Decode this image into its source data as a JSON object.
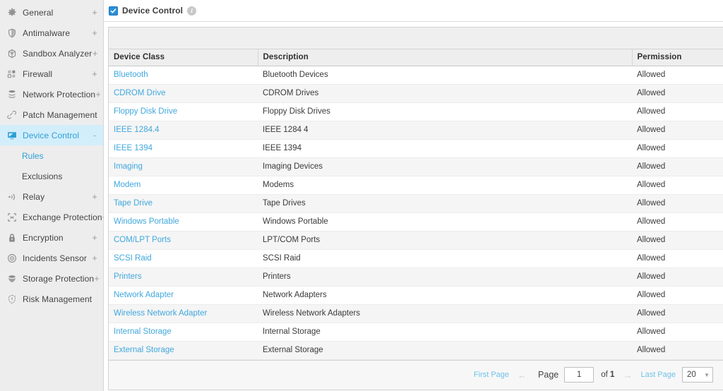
{
  "sidebar": {
    "items": [
      {
        "label": "General",
        "icon": "gear-icon",
        "expander": "+",
        "active": false
      },
      {
        "label": "Antimalware",
        "icon": "shield-half-icon",
        "expander": "+",
        "active": false
      },
      {
        "label": "Sandbox Analyzer",
        "icon": "box-icon",
        "expander": "+",
        "active": false
      },
      {
        "label": "Firewall",
        "icon": "blocks-icon",
        "expander": "+",
        "active": false
      },
      {
        "label": "Network Protection",
        "icon": "stack-icon",
        "expander": "+",
        "active": false
      },
      {
        "label": "Patch Management",
        "icon": "bandage-icon",
        "expander": "",
        "active": false
      },
      {
        "label": "Device Control",
        "icon": "monitor-icon",
        "expander": "-",
        "active": true
      },
      {
        "label": "Relay",
        "icon": "broadcast-icon",
        "expander": "+",
        "active": false
      },
      {
        "label": "Exchange Protection",
        "icon": "exchange-icon",
        "expander": "+",
        "active": false
      },
      {
        "label": "Encryption",
        "icon": "lock-icon",
        "expander": "+",
        "active": false
      },
      {
        "label": "Incidents Sensor",
        "icon": "target-icon",
        "expander": "+",
        "active": false
      },
      {
        "label": "Storage Protection",
        "icon": "storage-icon",
        "expander": "+",
        "active": false
      },
      {
        "label": "Risk Management",
        "icon": "risk-shield-icon",
        "expander": "",
        "active": false
      }
    ],
    "sub_items": [
      {
        "label": "Rules",
        "current": true
      },
      {
        "label": "Exclusions",
        "current": false
      }
    ],
    "sub_after_index": 6
  },
  "header": {
    "title": "Device Control",
    "checkbox_checked": true,
    "info_glyph": "i"
  },
  "table": {
    "columns": [
      "Device Class",
      "Description",
      "Permission"
    ],
    "rows": [
      {
        "device_class": "Bluetooth",
        "description": "Bluetooth Devices",
        "permission": "Allowed"
      },
      {
        "device_class": "CDROM Drive",
        "description": "CDROM Drives",
        "permission": "Allowed"
      },
      {
        "device_class": "Floppy Disk Drive",
        "description": "Floppy Disk Drives",
        "permission": "Allowed"
      },
      {
        "device_class": "IEEE 1284.4",
        "description": "IEEE 1284 4",
        "permission": "Allowed"
      },
      {
        "device_class": "IEEE 1394",
        "description": "IEEE 1394",
        "permission": "Allowed"
      },
      {
        "device_class": "Imaging",
        "description": "Imaging Devices",
        "permission": "Allowed"
      },
      {
        "device_class": "Modem",
        "description": "Modems",
        "permission": "Allowed"
      },
      {
        "device_class": "Tape Drive",
        "description": "Tape Drives",
        "permission": "Allowed"
      },
      {
        "device_class": "Windows Portable",
        "description": "Windows Portable",
        "permission": "Allowed"
      },
      {
        "device_class": "COM/LPT Ports",
        "description": "LPT/COM Ports",
        "permission": "Allowed"
      },
      {
        "device_class": "SCSI Raid",
        "description": "SCSI Raid",
        "permission": "Allowed"
      },
      {
        "device_class": "Printers",
        "description": "Printers",
        "permission": "Allowed"
      },
      {
        "device_class": "Network Adapter",
        "description": "Network Adapters",
        "permission": "Allowed"
      },
      {
        "device_class": "Wireless Network Adapter",
        "description": "Wireless Network Adapters",
        "permission": "Allowed"
      },
      {
        "device_class": "Internal Storage",
        "description": "Internal Storage",
        "permission": "Allowed"
      },
      {
        "device_class": "External Storage",
        "description": "External Storage",
        "permission": "Allowed"
      }
    ]
  },
  "pagination": {
    "first_page": "First Page",
    "prev_arrow": "←",
    "page_label": "Page",
    "page_value": "1",
    "of_text": "of",
    "total_pages": "1",
    "next_arrow": "→",
    "last_page": "Last Page",
    "page_size": "20",
    "caret": "▼"
  },
  "colors": {
    "accent_blue": "#41a8dd",
    "active_nav_bg": "#d3eefb",
    "checkbox_blue": "#2b8fd8",
    "sidebar_bg": "#ededed",
    "header_row_bg": "#eeeeee",
    "row_alt_bg": "#f5f5f5",
    "pager_bg": "#f7f7f7"
  }
}
